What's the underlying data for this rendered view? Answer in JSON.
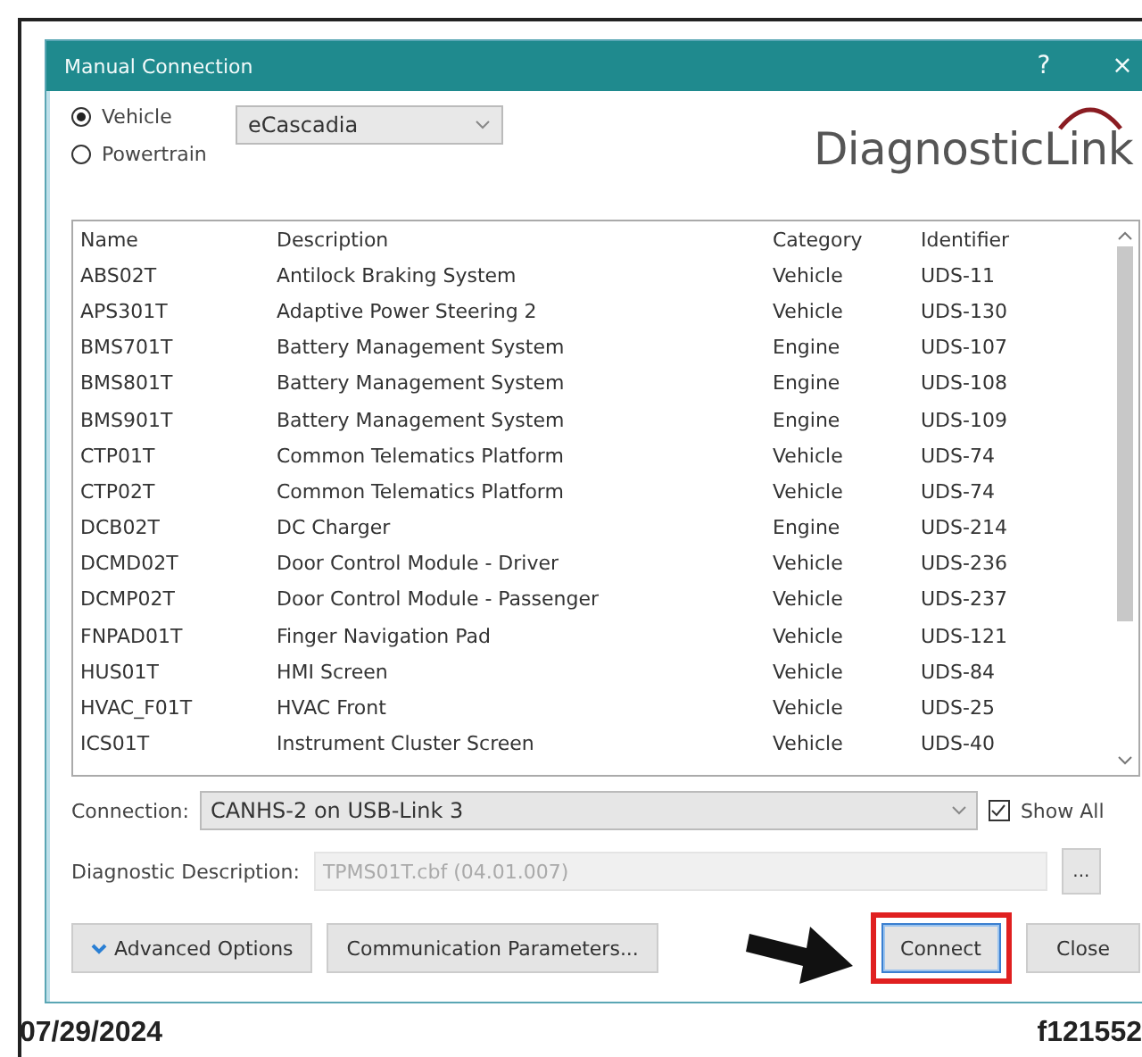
{
  "window": {
    "title": "Manual Connection",
    "help": "?",
    "close": "×"
  },
  "source": [
    {
      "label": "Vehicle",
      "selected": true
    },
    {
      "label": "Powertrain",
      "selected": false
    }
  ],
  "vehicle_select": {
    "value": "eCascadia"
  },
  "logo": "DiagnosticLink",
  "table": {
    "columns": [
      "Name",
      "Description",
      "Category",
      "Identifier"
    ],
    "rows": [
      [
        "ABS02T",
        "Antilock Braking System",
        "Vehicle",
        "UDS-11"
      ],
      [
        "APS301T",
        "Adaptive Power Steering 2",
        "Vehicle",
        "UDS-130"
      ],
      [
        "BMS701T",
        "Battery Management System",
        "Engine",
        "UDS-107"
      ],
      [
        "BMS801T",
        "Battery Management System",
        "Engine",
        "UDS-108"
      ],
      [
        "BMS901T",
        "Battery Management System",
        "Engine",
        "UDS-109"
      ],
      [
        "CTP01T",
        "Common Telematics Platform",
        "Vehicle",
        "UDS-74"
      ],
      [
        "CTP02T",
        "Common Telematics Platform",
        "Vehicle",
        "UDS-74"
      ],
      [
        "DCB02T",
        "DC Charger",
        "Engine",
        "UDS-214"
      ],
      [
        "DCMD02T",
        "Door Control Module - Driver",
        "Vehicle",
        "UDS-236"
      ],
      [
        "DCMP02T",
        "Door Control Module - Passenger",
        "Vehicle",
        "UDS-237"
      ],
      [
        "FNPAD01T",
        "Finger Navigation Pad",
        "Vehicle",
        "UDS-121"
      ],
      [
        "HUS01T",
        "HMI Screen",
        "Vehicle",
        "UDS-84"
      ],
      [
        "HVAC_F01T",
        "HVAC Front",
        "Vehicle",
        "UDS-25"
      ],
      [
        "ICS01T",
        "Instrument Cluster Screen",
        "Vehicle",
        "UDS-40"
      ]
    ]
  },
  "connection": {
    "label": "Connection:",
    "value": "CANHS-2 on USB-Link 3"
  },
  "show_all": {
    "label": "Show All",
    "checked": true
  },
  "diagnostic_description": {
    "label": "Diagnostic Description:",
    "value": "TPMS01T.cbf (04.01.007)",
    "disabled": true,
    "browse": "..."
  },
  "advanced_options": {
    "label": "Advanced Options"
  },
  "buttons": [
    {
      "label": "Communication Parameters...",
      "highlighted": false
    },
    {
      "label": "Connect",
      "highlighted": true
    },
    {
      "label": "Close",
      "highlighted": false
    }
  ],
  "footer": {
    "date": "07/29/2024",
    "figure_id": "f121552"
  }
}
